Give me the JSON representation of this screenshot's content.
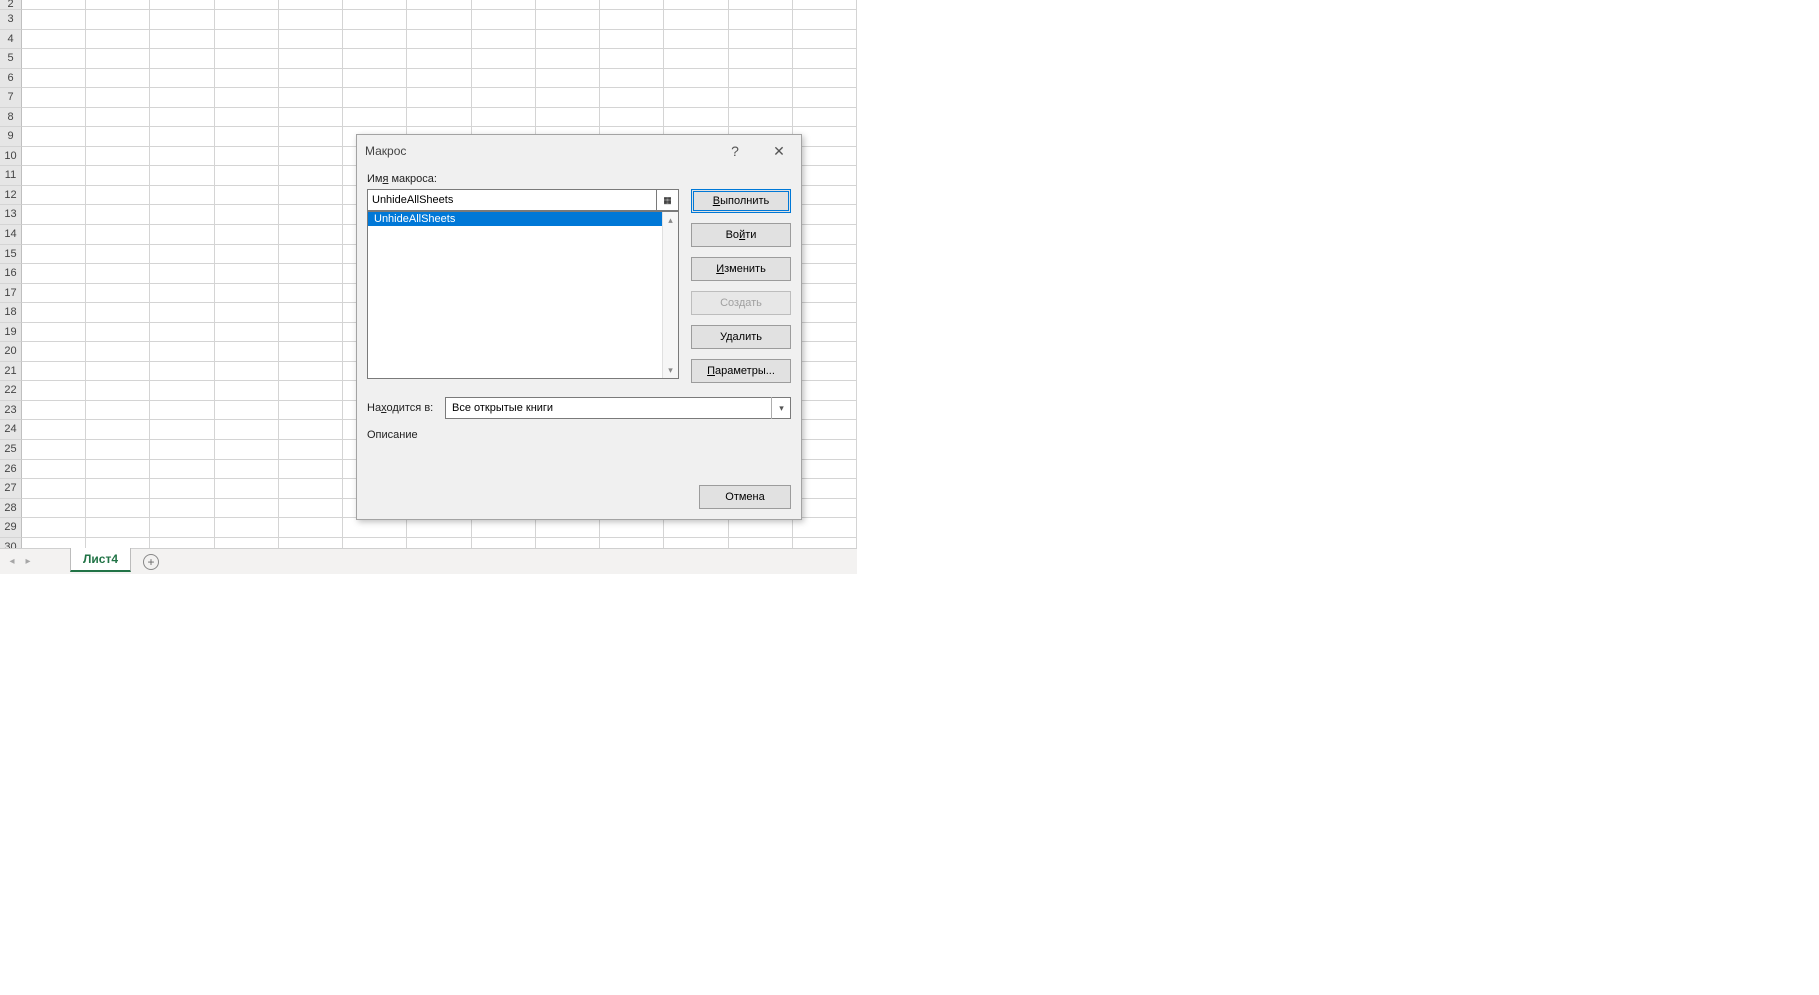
{
  "sheet": {
    "row_start": 2,
    "row_end": 30,
    "tab_label": "Лист4"
  },
  "dialog": {
    "title": "Макрос",
    "name_label": "Имя макроса:",
    "name_value": "UnhideAllSheets",
    "list_items": [
      "UnhideAllSheets"
    ],
    "selected_index": 0,
    "buttons": {
      "run": "Выполнить",
      "step": "Войти",
      "edit": "Изменить",
      "create": "Создать",
      "delete": "Удалить",
      "options": "Параметры...",
      "cancel": "Отмена"
    },
    "location_label": "Находится в:",
    "location_value": "Все открытые книги",
    "description_label": "Описание"
  }
}
